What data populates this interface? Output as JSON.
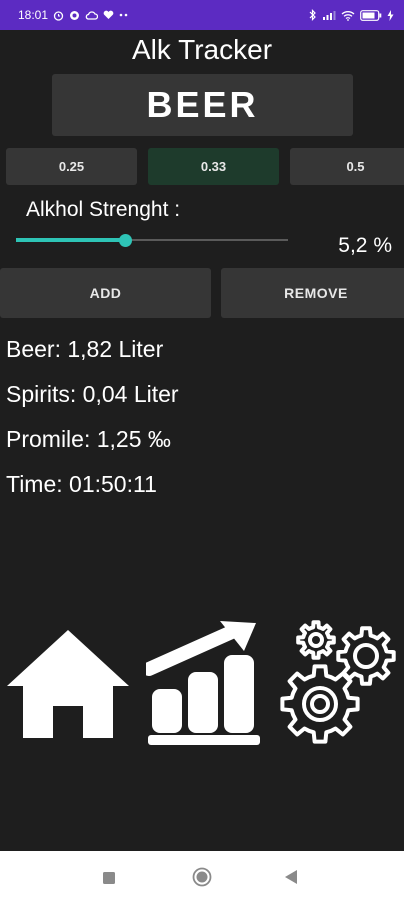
{
  "status_bar": {
    "time": "18:01",
    "left_icons": [
      "alarm-icon",
      "data-saver-icon",
      "cloud-icon",
      "heart-icon",
      "more-dots-icon"
    ],
    "right_icons": [
      "bluetooth-icon",
      "signal-icon",
      "wifi-icon",
      "battery-icon",
      "charging-icon"
    ],
    "background": "#5c2bc2"
  },
  "app": {
    "title": "Alk Tracker",
    "drink_type": "BEER"
  },
  "sizes": {
    "options": [
      "0.25",
      "0.33",
      "0.5"
    ],
    "selected": "0.33"
  },
  "strength": {
    "label": "Alkhol Strenght :",
    "value_text": "5,2 %",
    "slider_fraction": 0.4,
    "accent": "#2ec4b6"
  },
  "actions": {
    "add_label": "ADD",
    "remove_label": "REMOVE"
  },
  "stats": {
    "beer": "Beer: 1,82 Liter",
    "spirits": "Spirits: 0,04 Liter",
    "promile": "Promile: 1,25 ‰",
    "time": "Time: 01:50:11"
  },
  "bottom_nav": {
    "items": [
      "home-icon",
      "statistics-icon",
      "settings-icon"
    ]
  },
  "system_nav": {
    "items": [
      "recent-apps-icon",
      "home-circle-icon",
      "back-icon"
    ]
  }
}
